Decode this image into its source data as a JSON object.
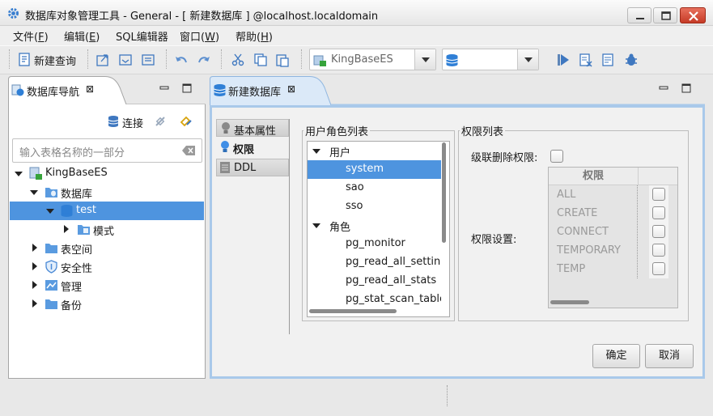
{
  "window": {
    "title": "数据库对象管理工具 - General - [ 新建数据库 ] @localhost.localdomain"
  },
  "menu": {
    "items": [
      {
        "label": "文件(",
        "key": "F",
        "end": ")"
      },
      {
        "label": "编辑(",
        "key": "E",
        "end": ")"
      },
      {
        "label": "SQL编辑器",
        "key": "",
        "end": ""
      },
      {
        "label": "窗口(",
        "key": "W",
        "end": ")"
      },
      {
        "label": "帮助(",
        "key": "H",
        "end": ")"
      }
    ]
  },
  "toolbar": {
    "new_query_label": "新建查询",
    "db_combo_value": "KingBaseES",
    "schema_combo_value": ""
  },
  "nav": {
    "tab_label": "数据库导航",
    "close_glyph": "⊠",
    "connect_label": "连接",
    "search_placeholder": "输入表格名称的一部分",
    "tree": {
      "root": "KingBaseES",
      "databases": "数据库",
      "test": "test",
      "schema": "模式",
      "tablespace": "表空间",
      "security": "安全性",
      "management": "管理",
      "backup": "备份"
    }
  },
  "editor": {
    "tab_label": "新建数据库",
    "close_glyph": "⊠",
    "vtabs": {
      "basic": "基本属性",
      "permissions": "权限",
      "ddl": "DDL"
    },
    "role_group_title": "用户角色列表",
    "roles": {
      "users_header": "用户",
      "users": [
        "system",
        "sao",
        "sso"
      ],
      "roles_header": "角色",
      "roles": [
        "pg_monitor",
        "pg_read_all_settings",
        "pg_read_all_stats",
        "pg_stat_scan_tables"
      ]
    },
    "perm_group_title": "权限列表",
    "cascade_label": "级联删除权限:",
    "perm_settings_label": "权限设置:",
    "perm_table_header": "权限",
    "permissions": [
      "ALL",
      "CREATE",
      "CONNECT",
      "TEMPORARY",
      "TEMP"
    ],
    "ok_button": "确定",
    "cancel_button": "取消"
  },
  "colors": {
    "selection": "#4e94df",
    "active_tab_border": "#a9c9ea"
  }
}
